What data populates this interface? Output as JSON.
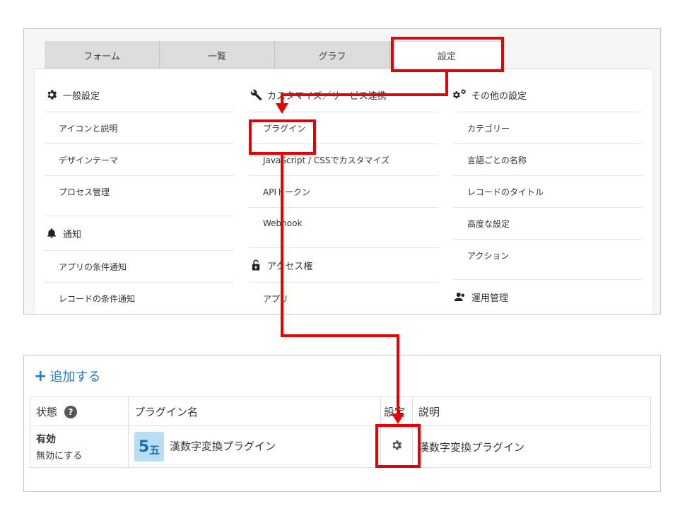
{
  "tabs": [
    {
      "label": "フォーム",
      "active": false
    },
    {
      "label": "一覧",
      "active": false
    },
    {
      "label": "グラフ",
      "active": false
    },
    {
      "label": "設定",
      "active": true
    }
  ],
  "general": {
    "heading": "一般設定",
    "icon": "gear-icon",
    "items": [
      "アイコンと説明",
      "デザインテーマ",
      "プロセス管理"
    ]
  },
  "notify": {
    "heading": "通知",
    "icon": "bell-icon",
    "items": [
      "アプリの条件通知",
      "レコードの条件通知"
    ]
  },
  "customize": {
    "heading": "カスタマイズ／サービス連携",
    "icon": "wrench-icon",
    "items": [
      "プラグイン",
      "JavaScript / CSSでカスタマイズ",
      "APIトークン",
      "Webhook"
    ]
  },
  "access": {
    "heading": "アクセス権",
    "icon": "unlock-icon",
    "items": [
      "アプリ"
    ]
  },
  "other": {
    "heading": "その他の設定",
    "icon": "gears-icon",
    "items": [
      "カテゴリー",
      "言語ごとの名称",
      "レコードのタイトル",
      "高度な設定",
      "アクション"
    ]
  },
  "ops": {
    "heading": "運用管理",
    "icon": "people-icon"
  },
  "plugin_panel": {
    "add_label": "追加する",
    "headers": {
      "status": "状態",
      "help": "?",
      "name": "プラグイン名",
      "settings": "設定",
      "desc": "説明"
    },
    "rows": [
      {
        "status": "有効",
        "toggle": "無効にする",
        "logo_big": "5",
        "logo_small": "五",
        "name": "漢数字変換プラグイン",
        "desc": "漢数字変換プラグイン"
      }
    ]
  },
  "colors": {
    "accent": "#2a7ac7",
    "highlight": "#e60000",
    "logo_bg": "#b9ddf3"
  }
}
